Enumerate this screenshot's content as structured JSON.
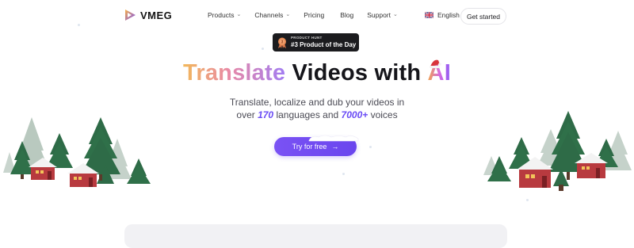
{
  "brand": {
    "name": "VMEG"
  },
  "nav": {
    "items": [
      {
        "label": "Products",
        "has_dropdown": true
      },
      {
        "label": "Channels",
        "has_dropdown": true
      },
      {
        "label": "Pricing",
        "has_dropdown": false
      },
      {
        "label": "Blog",
        "has_dropdown": false
      },
      {
        "label": "Support",
        "has_dropdown": true
      }
    ],
    "language": "English",
    "language_icon": "uk-flag-icon",
    "cta_label": "Get started"
  },
  "badge": {
    "small": "PRODUCT HUNT",
    "big": "#3 Product of the Day",
    "icon": "medal-icon"
  },
  "hero": {
    "title_highlight": "Translate",
    "title_rest": "Videos with",
    "title_ai": "AI",
    "sub_line1": "Translate, localize and dub your videos in",
    "sub_over": "over",
    "sub_languages_num": "170",
    "sub_languages_text": "languages and",
    "sub_voices_num": "7000+",
    "sub_voices_text": "voices",
    "cta_label": "Try for free",
    "cta_arrow": "→"
  },
  "colors": {
    "accent": "#6a46ee",
    "tree_dark": "#2e6b47",
    "tree_light": "#b9c9bf",
    "house": "#b83a3f"
  }
}
